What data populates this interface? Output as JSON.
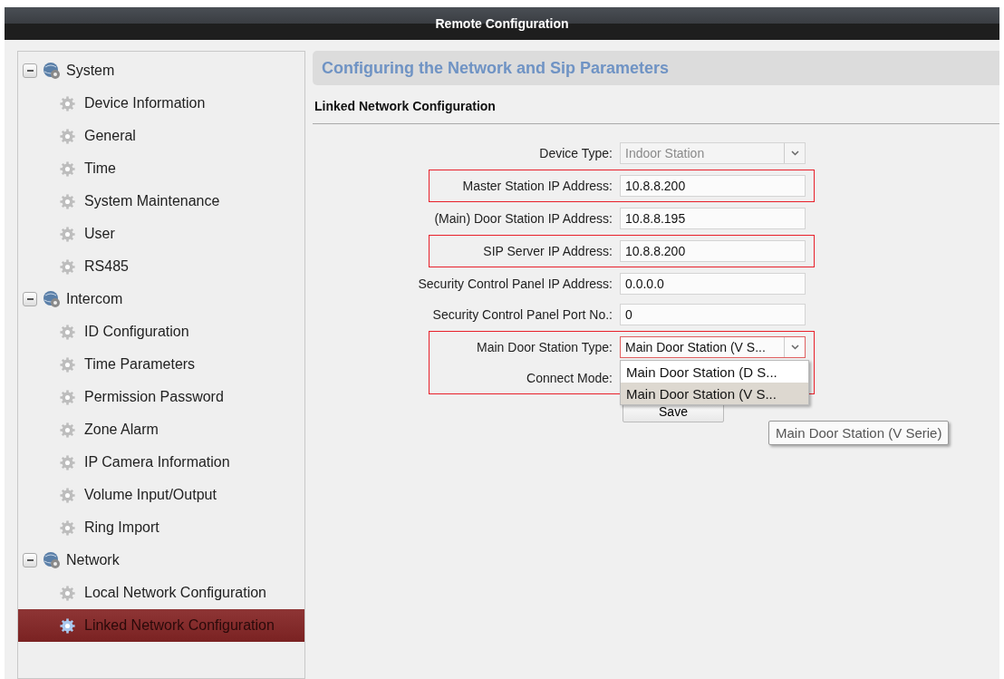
{
  "window": {
    "title": "Remote Configuration"
  },
  "sidebar": {
    "items": [
      {
        "label": "System",
        "expanded": true,
        "children": [
          {
            "label": "Device Information",
            "selected": false
          },
          {
            "label": "General",
            "selected": false
          },
          {
            "label": "Time",
            "selected": false
          },
          {
            "label": "System Maintenance",
            "selected": false
          },
          {
            "label": "User",
            "selected": false
          },
          {
            "label": "RS485",
            "selected": false
          }
        ]
      },
      {
        "label": "Intercom",
        "expanded": true,
        "children": [
          {
            "label": "ID Configuration",
            "selected": false
          },
          {
            "label": "Time Parameters",
            "selected": false
          },
          {
            "label": "Permission Password",
            "selected": false
          },
          {
            "label": "Zone Alarm",
            "selected": false
          },
          {
            "label": "IP Camera Information",
            "selected": false
          },
          {
            "label": "Volume Input/Output",
            "selected": false
          },
          {
            "label": "Ring Import",
            "selected": false
          }
        ]
      },
      {
        "label": "Network",
        "expanded": true,
        "children": [
          {
            "label": "Local Network Configuration",
            "selected": false
          },
          {
            "label": "Linked Network Configuration",
            "selected": true
          }
        ]
      }
    ]
  },
  "page": {
    "title": "Configuring the Network and Sip Parameters",
    "section": "Linked Network Configuration"
  },
  "field_groups": [
    {
      "highlighted": false,
      "fields": [
        {
          "kind": "select",
          "label": "Device Type:",
          "value": "Indoor Station",
          "disabled": true
        }
      ]
    },
    {
      "highlighted": true,
      "fields": [
        {
          "kind": "text",
          "label": "Master Station IP Address:",
          "value": "10.8.8.200"
        }
      ]
    },
    {
      "highlighted": false,
      "fields": [
        {
          "kind": "text",
          "label": "(Main) Door Station IP Address:",
          "value": "10.8.8.195"
        }
      ]
    },
    {
      "highlighted": true,
      "fields": [
        {
          "kind": "text",
          "label": "SIP Server IP Address:",
          "value": "10.8.8.200"
        }
      ]
    },
    {
      "highlighted": false,
      "fields": [
        {
          "kind": "text",
          "label": "Security Control Panel IP Address:",
          "value": "0.0.0.0"
        },
        {
          "kind": "text",
          "label": "Security Control Panel Port No.:",
          "value": "0"
        }
      ]
    },
    {
      "highlighted": true,
      "fields": [
        {
          "kind": "select",
          "label": "Main Door Station Type:",
          "value": "Main Door Station (V S...",
          "disabled": false,
          "open": true,
          "options": [
            {
              "label": "Main Door Station (D S...",
              "selected": false
            },
            {
              "label": "Main Door Station (V S...",
              "selected": true
            }
          ]
        },
        {
          "kind": "hidden",
          "label": "Connect Mode:"
        }
      ]
    }
  ],
  "save_button": "Save",
  "tooltip": "Main Door Station (V Serie)"
}
